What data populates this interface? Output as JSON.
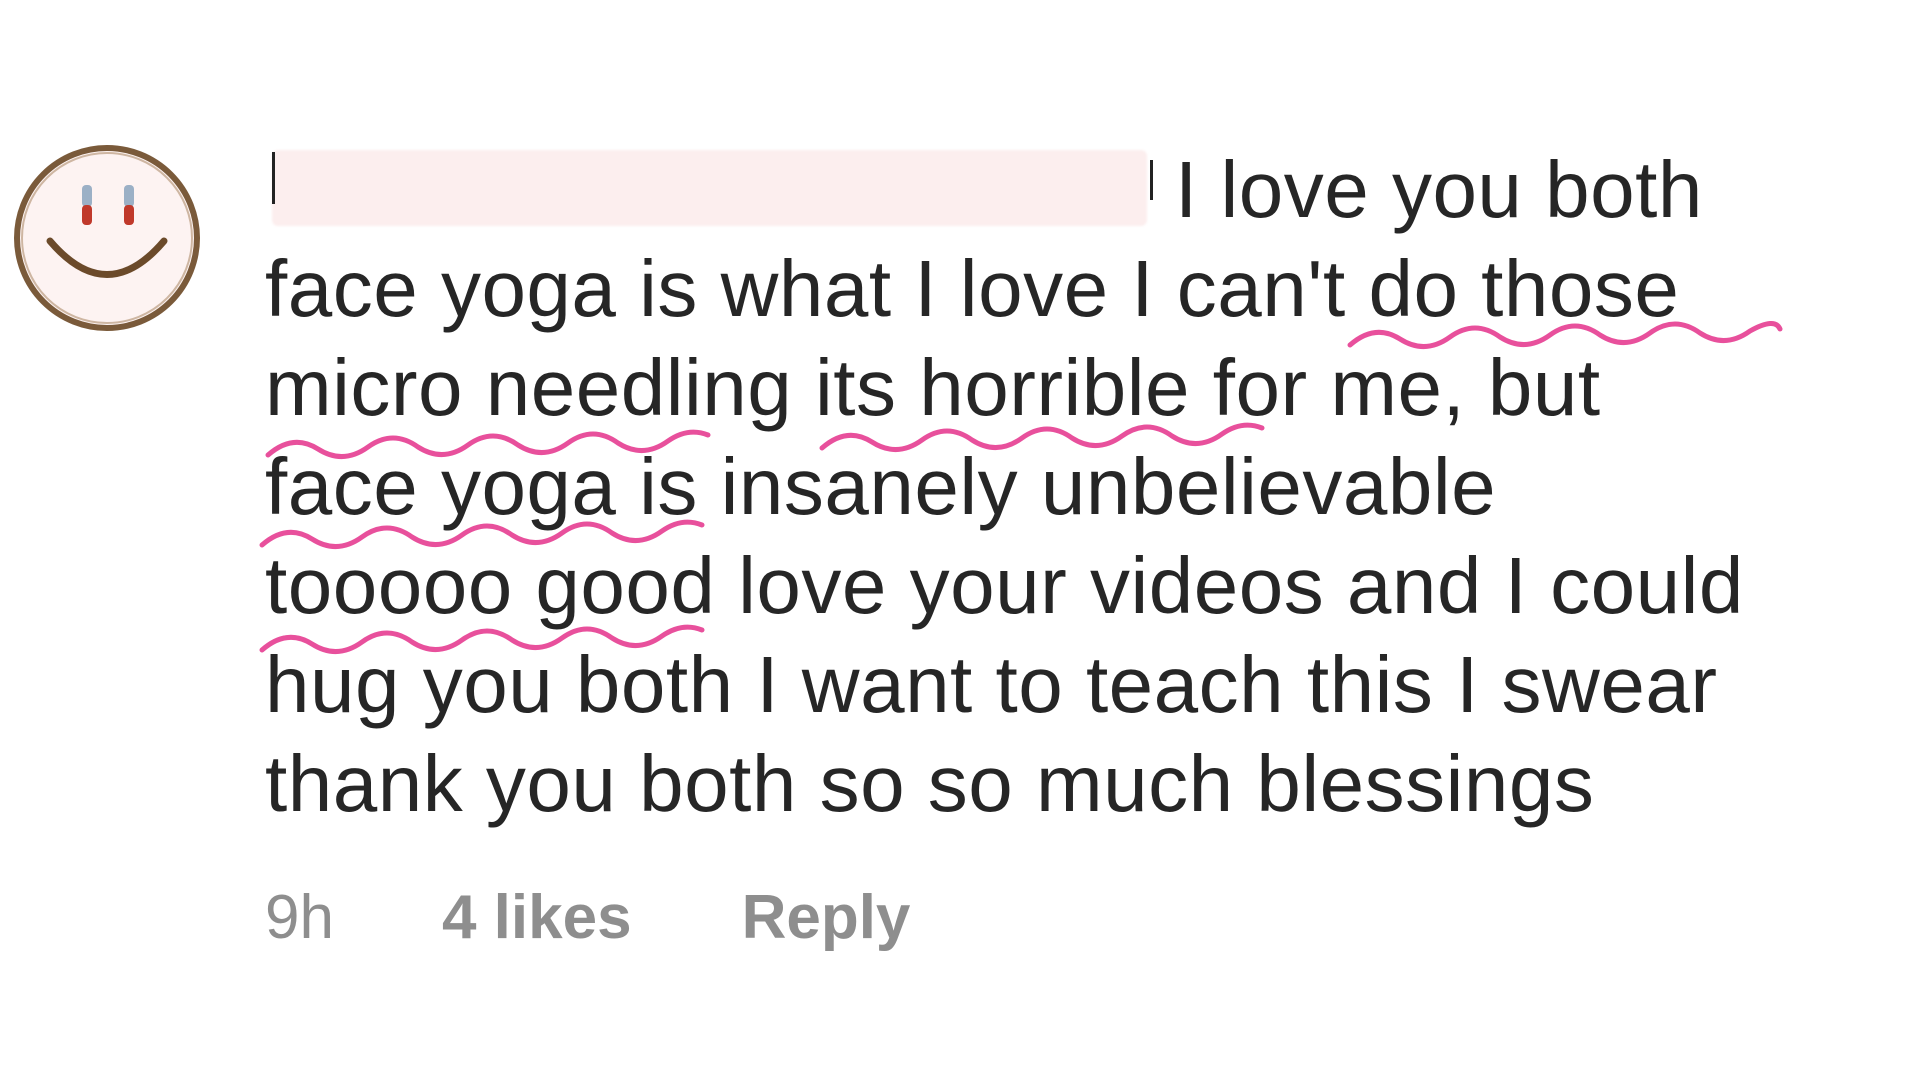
{
  "avatar": {
    "icon": "smiley-face-icon",
    "colors": {
      "outline": "#7a5a3a",
      "fill": "#fdf3f2",
      "eye_top": "#9bb0c6",
      "eye_bottom": "#c0392b",
      "mouth": "#6b4a2a"
    }
  },
  "comment": {
    "username_redacted": true,
    "lines": [
      "I love you both",
      "face yoga is what I love  I can't do those",
      "micro needling its horrible for me, but",
      "face yoga is insanely unbelievable",
      "tooooo good love your videos and I could",
      "hug you both I want to teach this I swear",
      "thank you both so so much blessings"
    ],
    "highlight_color": "#e8509c"
  },
  "meta": {
    "time": "9h",
    "likes": "4 likes",
    "reply": "Reply"
  }
}
